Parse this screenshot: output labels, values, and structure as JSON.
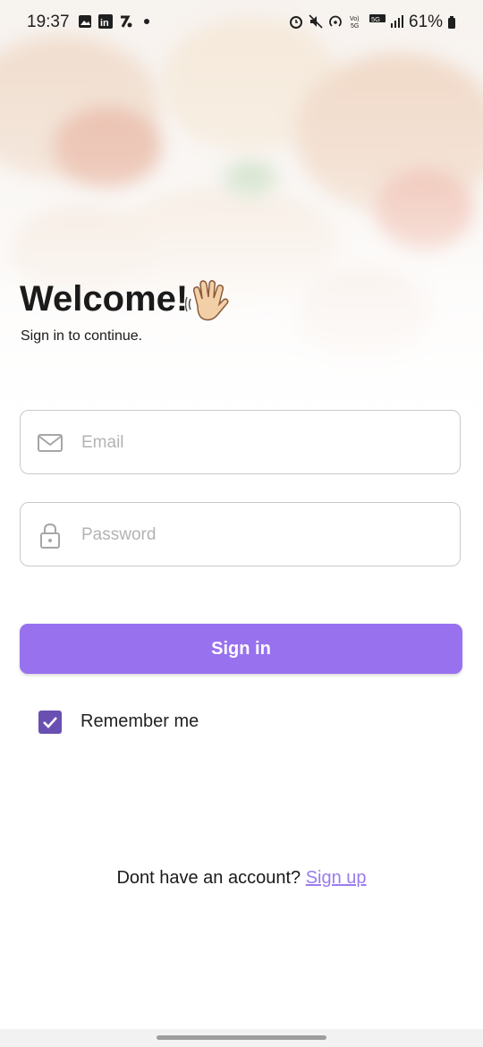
{
  "status_bar": {
    "time": "19:37",
    "battery": "61%",
    "left_icons": [
      "gallery-icon",
      "linkedin-icon",
      "percent-app-icon",
      "dot-icon"
    ],
    "right_icons": [
      "alarm-icon",
      "mute-icon",
      "hotspot-icon",
      "volte-icon",
      "5g-icon",
      "signal-icon",
      "battery-icon"
    ]
  },
  "welcome": {
    "title": "Welcome!",
    "emoji": "waving-hand-icon",
    "subtitle": "Sign in to continue."
  },
  "form": {
    "email_placeholder": "Email",
    "email_value": "",
    "password_placeholder": "Password",
    "password_value": "",
    "sign_in_label": "Sign in",
    "remember_label": "Remember me",
    "remember_checked": true
  },
  "footer": {
    "prompt": "Dont have an account?",
    "link": "Sign up"
  },
  "colors": {
    "accent": "#9871ef",
    "checkbox": "#6a4fb3",
    "link": "#9a7cf0"
  }
}
